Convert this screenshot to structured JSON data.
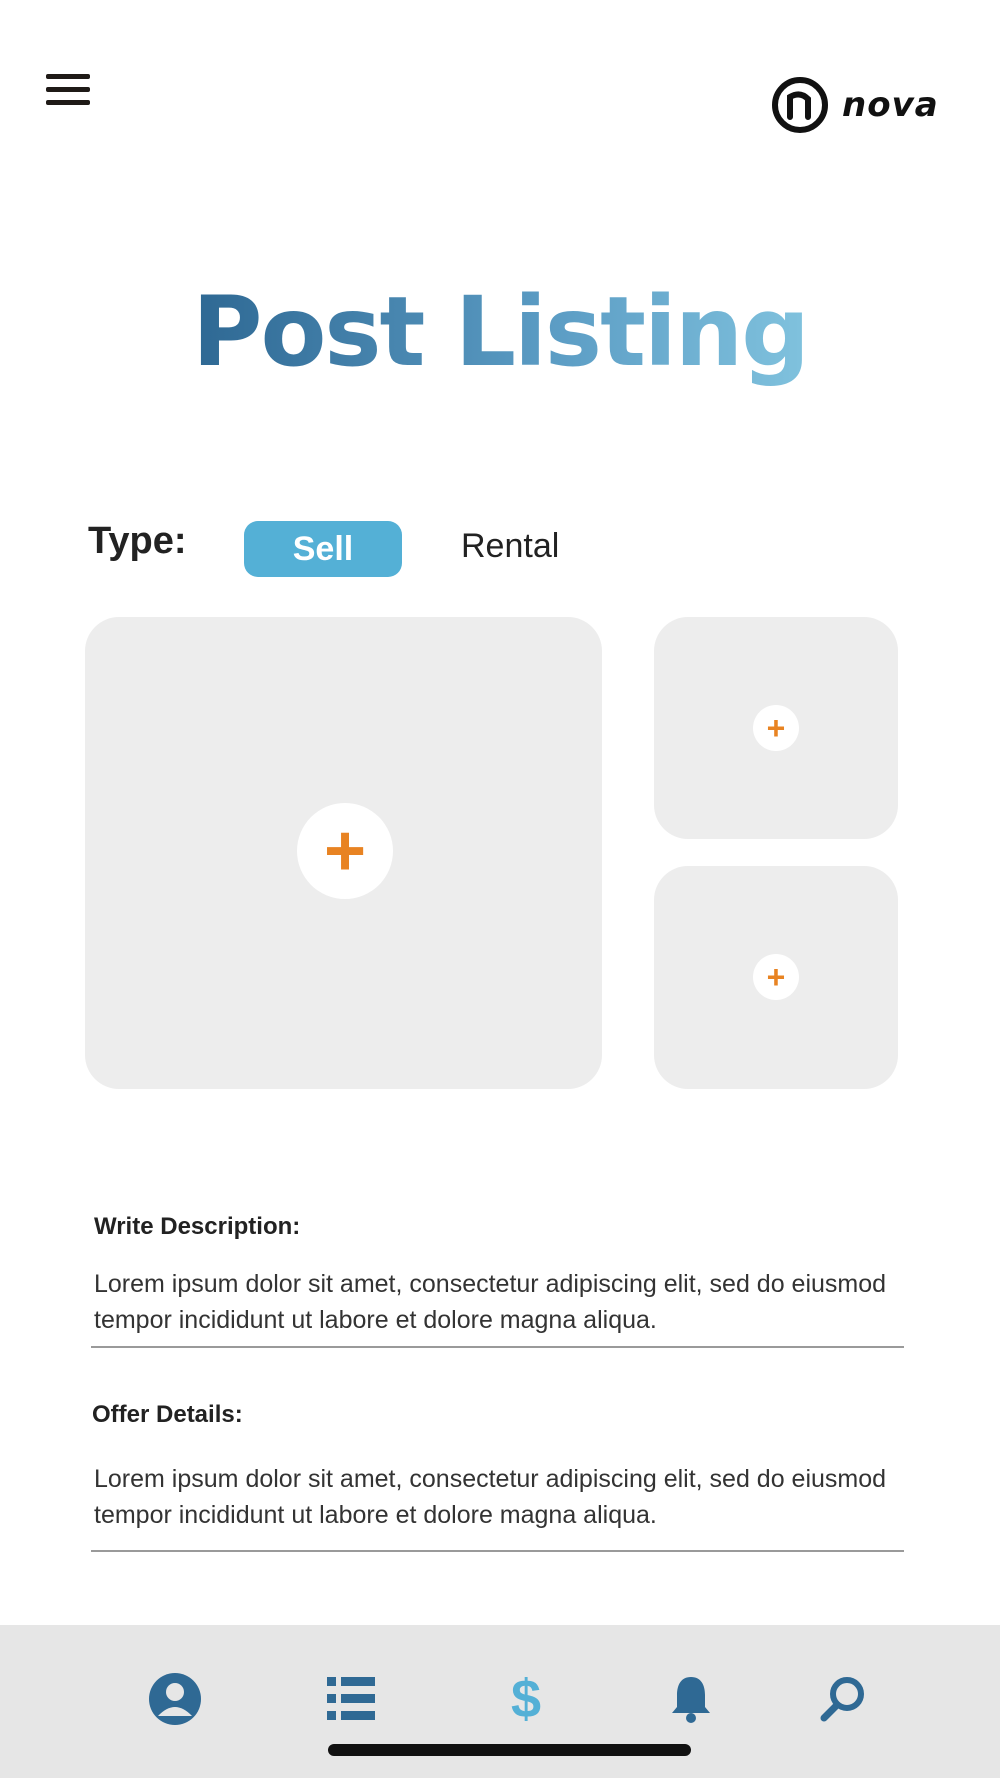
{
  "header": {
    "menu_icon": "hamburger-menu-icon",
    "logo_text": "nova"
  },
  "page_title": "Post Listing",
  "type_selector": {
    "label": "Type:",
    "options": [
      "Sell",
      "Rental"
    ],
    "selected": "Sell"
  },
  "photos": {
    "add_icon": "plus-icon",
    "slots": 3
  },
  "description": {
    "label": "Write Description:",
    "value": "Lorem ipsum dolor sit amet, consectetur adipiscing elit, sed do eiusmod tempor incididunt ut labore et dolore magna aliqua."
  },
  "offer_details": {
    "label": "Offer Details:",
    "value": "Lorem ipsum dolor sit amet, consectetur adipiscing elit, sed do eiusmod tempor incididunt ut labore et dolore magna aliqua."
  },
  "bottom_nav": {
    "items": [
      "profile-icon",
      "list-icon",
      "dollar-icon",
      "bell-icon",
      "search-icon"
    ],
    "active": "dollar-icon"
  },
  "colors": {
    "accent_blue": "#54b0d6",
    "nav_blue": "#2f6994",
    "plus_orange": "#e88322",
    "title_gradient_start": "#2f6994",
    "title_gradient_end": "#7fc1dd"
  }
}
